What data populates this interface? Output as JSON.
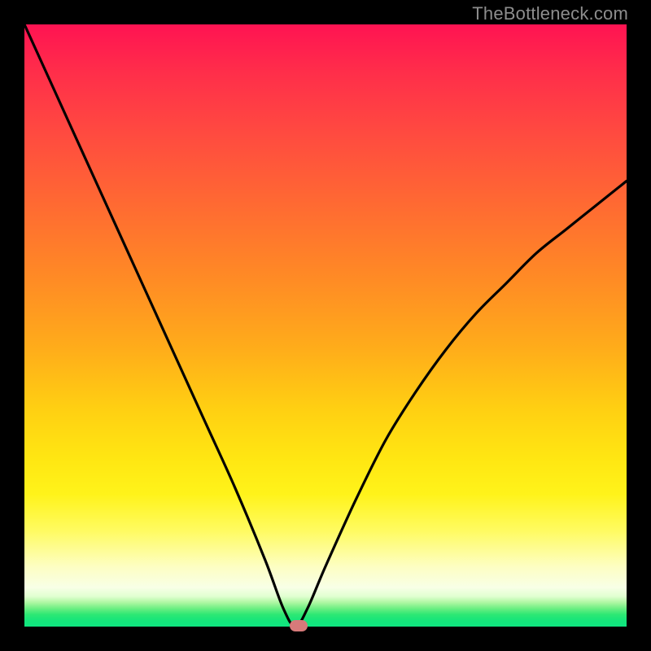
{
  "watermark": "TheBottleneck.com",
  "colors": {
    "curve": "#000000",
    "marker": "#d77a7a",
    "frame": "#000000"
  },
  "chart_data": {
    "type": "line",
    "title": "",
    "xlabel": "",
    "ylabel": "",
    "xlim": [
      0,
      100
    ],
    "ylim": [
      0,
      100
    ],
    "grid": false,
    "series": [
      {
        "name": "bottleneck-curve",
        "x": [
          0,
          5,
          10,
          15,
          20,
          25,
          30,
          35,
          40,
          43,
          45,
          47,
          50,
          55,
          60,
          65,
          70,
          75,
          80,
          85,
          90,
          95,
          100
        ],
        "values": [
          100,
          89,
          78,
          67,
          56,
          45,
          34,
          23,
          11,
          3,
          0,
          3,
          10,
          21,
          31,
          39,
          46,
          52,
          57,
          62,
          66,
          70,
          74
        ]
      }
    ],
    "marker": {
      "x": 45.5,
      "y": 0,
      "width": 3,
      "height": 2
    },
    "gradient_stops": [
      {
        "pos": 0,
        "color": "#ff1352"
      },
      {
        "pos": 50,
        "color": "#ff8a25"
      },
      {
        "pos": 78,
        "color": "#fff31a"
      },
      {
        "pos": 93,
        "color": "#f8ffe6"
      },
      {
        "pos": 100,
        "color": "#0fe580"
      }
    ]
  }
}
